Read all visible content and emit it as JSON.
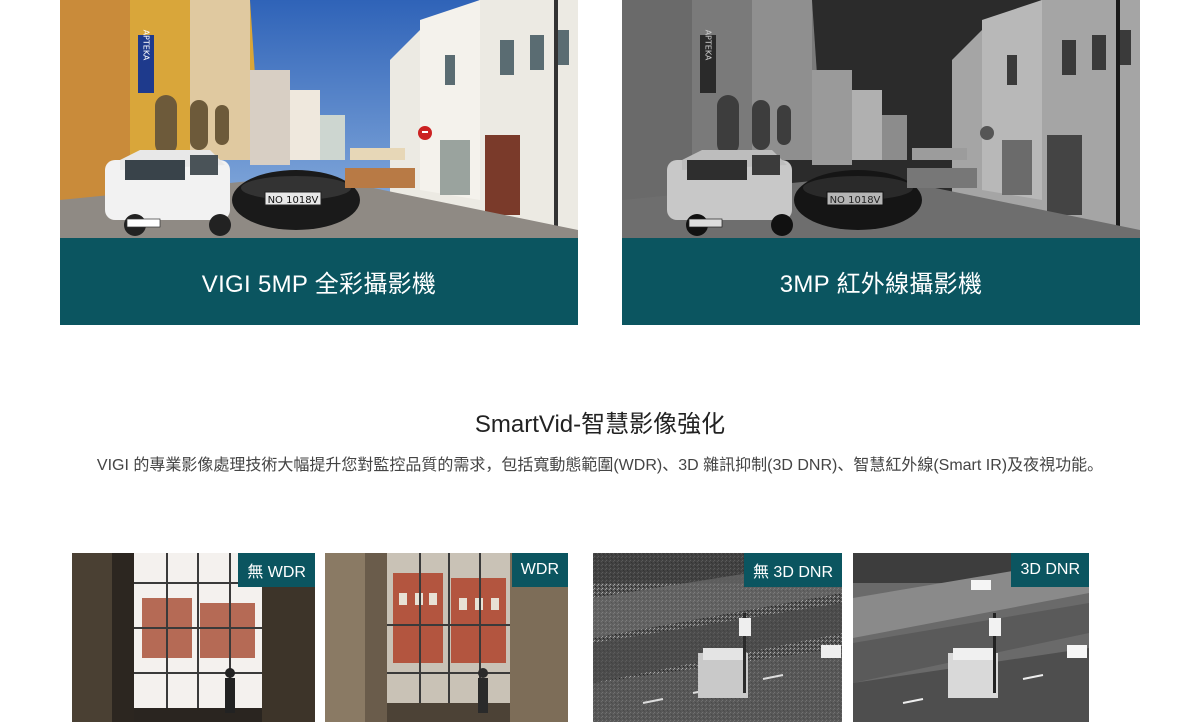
{
  "cards": [
    {
      "caption": "VIGI 5MP 全彩攝影機",
      "plate": "NO 1018V",
      "sign": "APTEKA"
    },
    {
      "caption": "3MP 紅外線攝影機",
      "plate": "NO 1018V",
      "sign": "APTEKA"
    }
  ],
  "section": {
    "title": "SmartVid-智慧影像強化",
    "description": "VIGI 的專業影像處理技術大幅提升您對監控品質的需求，包括寬動態範圍(WDR)、3D 雜訊抑制(3D DNR)、智慧紅外線(Smart IR)及夜視功能。"
  },
  "thumbnails": [
    {
      "tag": "無 WDR"
    },
    {
      "tag": "WDR"
    },
    {
      "tag": "無 3D DNR"
    },
    {
      "tag": "3D DNR"
    }
  ],
  "colors": {
    "accent": "#0b5560"
  }
}
